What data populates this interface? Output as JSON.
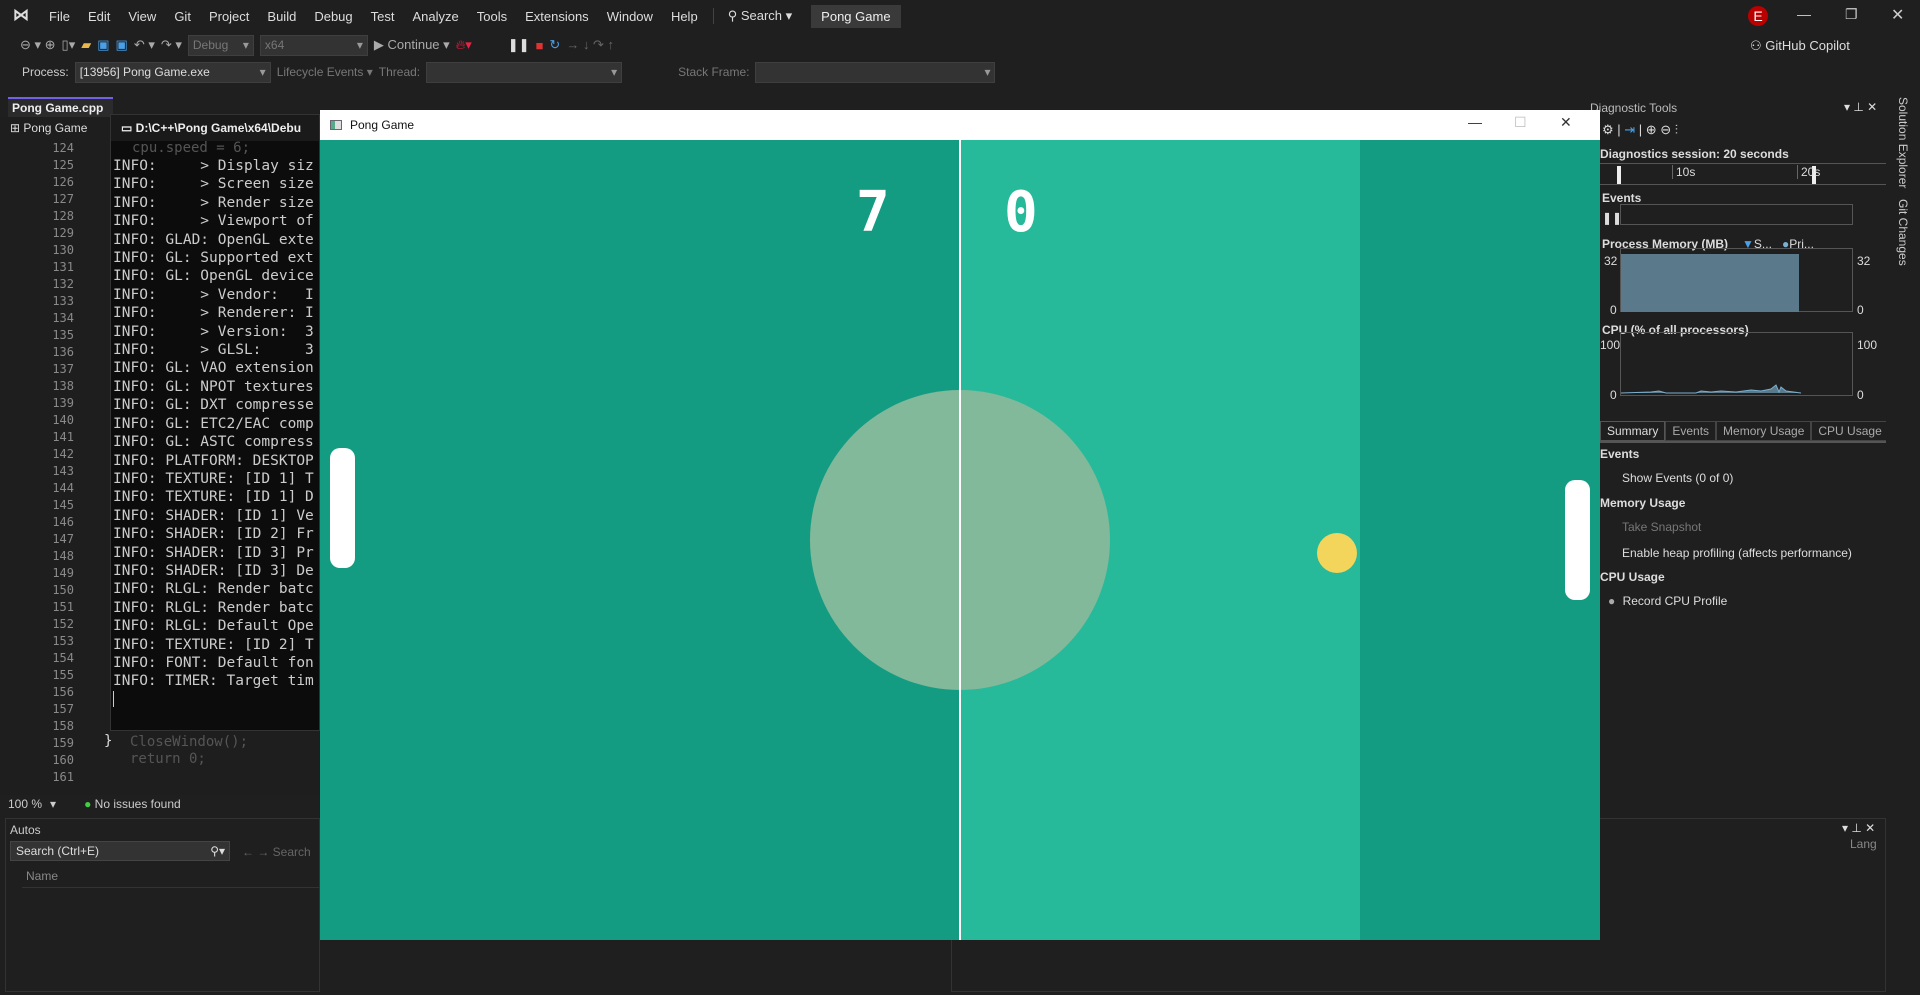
{
  "menu": {
    "items": [
      "File",
      "Edit",
      "View",
      "Git",
      "Project",
      "Build",
      "Debug",
      "Test",
      "Analyze",
      "Tools",
      "Extensions",
      "Window",
      "Help"
    ],
    "search": "Search",
    "solution": "Pong Game",
    "avatar": "E",
    "copilot": "GitHub Copilot"
  },
  "toolbar": {
    "config": "Debug",
    "platform": "x64",
    "continue": "Continue"
  },
  "procbar": {
    "process_label": "Process:",
    "process": "[13956] Pong Game.exe",
    "lifecycle": "Lifecycle Events",
    "thread_label": "Thread:",
    "stack_label": "Stack Frame:"
  },
  "editor": {
    "tab": "Pong Game.cpp",
    "scope": "Pong Game",
    "line_numbers": [
      "124",
      "125",
      "126",
      "127",
      "128",
      "129",
      "130",
      "131",
      "132",
      "133",
      "134",
      "135",
      "136",
      "137",
      "138",
      "139",
      "140",
      "141",
      "142",
      "143",
      "144",
      "145",
      "146",
      "147",
      "148",
      "149",
      "150",
      "151",
      "152",
      "153",
      "154",
      "155",
      "156",
      "157",
      "158",
      "159",
      "160",
      "161"
    ],
    "ghost": {
      "first": "cpu.speed = 6;",
      "close": "CloseWindow();",
      "ret": "return 0;",
      "brace": "}"
    }
  },
  "console": {
    "title": "D:\\C++\\Pong Game\\x64\\Debu",
    "lines": [
      "INFO:     > Display siz",
      "INFO:     > Screen size",
      "INFO:     > Render size",
      "INFO:     > Viewport of",
      "INFO: GLAD: OpenGL exte",
      "INFO: GL: Supported ext",
      "INFO: GL: OpenGL device",
      "INFO:     > Vendor:   I",
      "INFO:     > Renderer: I",
      "INFO:     > Version:  3",
      "INFO:     > GLSL:     3",
      "INFO: GL: VAO extension",
      "INFO: GL: NPOT textures",
      "INFO: GL: DXT compresse",
      "INFO: GL: ETC2/EAC comp",
      "INFO: GL: ASTC compress",
      "INFO: PLATFORM: DESKTOP",
      "INFO: TEXTURE: [ID 1] T",
      "INFO: TEXTURE: [ID 1] D",
      "INFO: SHADER: [ID 1] Ve",
      "INFO: SHADER: [ID 2] Fr",
      "INFO: SHADER: [ID 3] Pr",
      "INFO: SHADER: [ID 3] De",
      "INFO: RLGL: Render batc",
      "INFO: RLGL: Render batc",
      "INFO: RLGL: Default Ope",
      "INFO: TEXTURE: [ID 2] T",
      "INFO: FONT: Default fon",
      "INFO: TIMER: Target tim"
    ]
  },
  "game": {
    "title": "Pong Game",
    "score_cpu": "7",
    "score_player": "0",
    "colors": {
      "dark": "#149c82",
      "light": "#26b99a",
      "circle": "#81b99a",
      "ball": "#f3d55b",
      "paddle": "#ffffff"
    }
  },
  "diagnostics": {
    "title": "Diagnostic Tools",
    "session": "Diagnostics session: 20 seconds",
    "ticks": [
      "10s",
      "20s"
    ],
    "events": "Events",
    "memory_label": "Process Memory (MB)",
    "legend": [
      "S...",
      "Pri..."
    ],
    "mem_max": "32",
    "mem_min": "0",
    "mem_fill_pct": 77,
    "cpu_label": "CPU (% of all processors)",
    "cpu_max": "100",
    "cpu_min": "0",
    "tabs": [
      "Summary",
      "Events",
      "Memory Usage",
      "CPU Usage"
    ],
    "sections": {
      "events": "Events",
      "show_events": "Show Events (0 of 0)",
      "memory": "Memory Usage",
      "snapshot": "Take Snapshot",
      "heap": "Enable heap profiling (affects performance)",
      "cpu": "CPU Usage",
      "record": "Record CPU Profile"
    }
  },
  "side_tabs": [
    "Solution Explorer",
    "Git Changes"
  ],
  "status": {
    "zoom": "100 %",
    "issues": "No issues found"
  },
  "autos": {
    "title": "Autos",
    "search": "Search (Ctrl+E)",
    "search2": "Search",
    "col_name": "Name"
  },
  "bottom_right": {
    "col": "Lang"
  }
}
